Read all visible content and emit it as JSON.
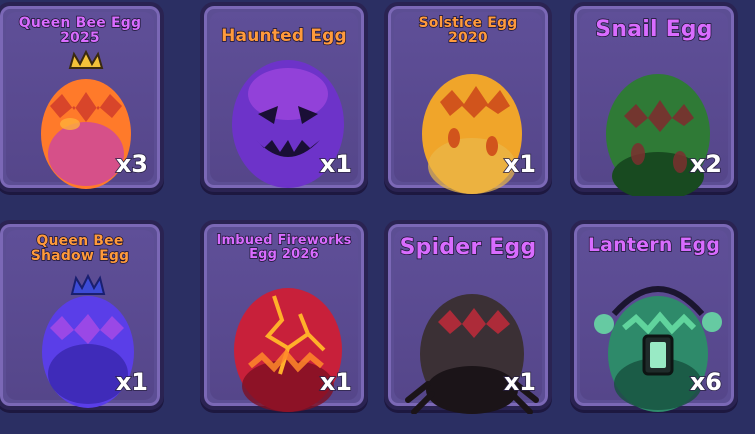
{
  "eggs": [
    {
      "title_line1": "Queen Bee Egg",
      "title_line2": "2025",
      "count": "x3",
      "title_color": "#d96cff",
      "size": "small",
      "icon": "queen-bee-egg-icon",
      "colors": [
        "#ff7a2a",
        "#c43fb2",
        "#ffb03a"
      ]
    },
    {
      "title_line1": "Haunted Egg",
      "title_line2": "",
      "count": "x1",
      "title_color": "#ff9a3c",
      "size": "small",
      "icon": "haunted-egg-icon",
      "colors": [
        "#7d3bd6",
        "#3a1c7a",
        "#b04ce6"
      ]
    },
    {
      "title_line1": "Solstice Egg",
      "title_line2": "2020",
      "count": "x1",
      "title_color": "#ff9a3c",
      "size": "small",
      "icon": "solstice-egg-icon",
      "colors": [
        "#f0a52a",
        "#d1541c",
        "#ffd06a"
      ]
    },
    {
      "title_line1": "Snail Egg",
      "title_line2": "",
      "count": "x2",
      "title_color": "#d96cff",
      "size": "big",
      "icon": "snail-egg-icon",
      "colors": [
        "#2f7a36",
        "#184a20",
        "#7b2f2f"
      ]
    },
    {
      "title_line1": "Queen Bee",
      "title_line2": "Shadow Egg",
      "count": "x1",
      "title_color": "#ff9a3c",
      "size": "small",
      "icon": "queen-bee-shadow-egg-icon",
      "colors": [
        "#5a3ee8",
        "#2d1f9a",
        "#b04ce6"
      ]
    },
    {
      "title_line1": "Imbued Fireworks",
      "title_line2": "Egg 2026",
      "count": "x1",
      "title_color": "#d96cff",
      "size": "small",
      "icon": "imbued-fireworks-egg-icon",
      "colors": [
        "#c8203a",
        "#7e0f22",
        "#ffb02a"
      ]
    },
    {
      "title_line1": "Spider Egg",
      "title_line2": "",
      "count": "x1",
      "title_color": "#d96cff",
      "size": "big",
      "icon": "spider-egg-icon",
      "colors": [
        "#3b3035",
        "#1b1418",
        "#c22a3a"
      ]
    },
    {
      "title_line1": "Lantern Egg",
      "title_line2": "",
      "count": "x6",
      "title_color": "#d96cff",
      "size": "big",
      "icon": "lantern-egg-icon",
      "colors": [
        "#2e8a6a",
        "#17503e",
        "#69e0a6"
      ]
    }
  ]
}
